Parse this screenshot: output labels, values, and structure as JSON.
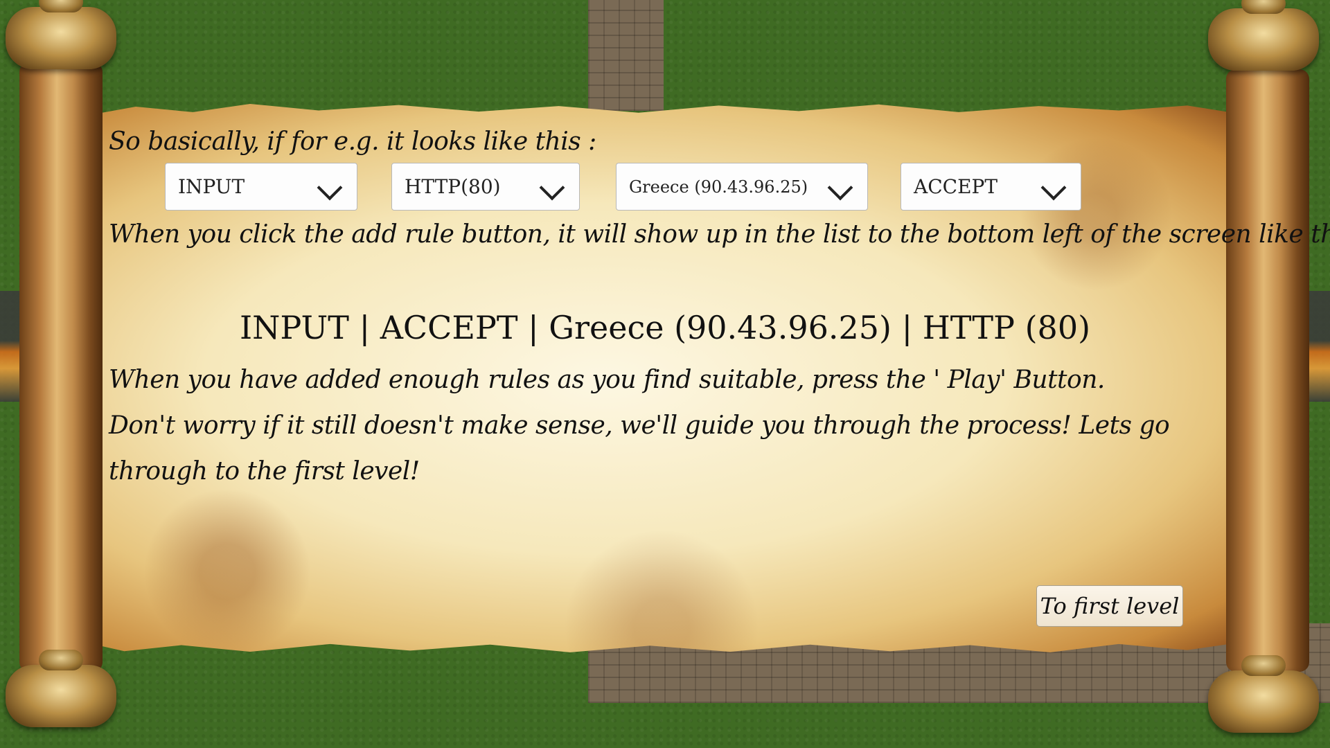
{
  "tutorial": {
    "intro": "So basically, if for e.g. it looks like this :",
    "dropdowns": {
      "direction": "INPUT",
      "protocol": "HTTP(80)",
      "address": "Greece (90.43.96.25)",
      "action": "ACCEPT"
    },
    "after_click": "When you click the add rule button, it will show up in the list to the bottom left of the screen like this:",
    "rule_preview": "INPUT | ACCEPT | Greece (90.43.96.25) | HTTP (80)",
    "final_text": "When you have added enough rules as you find suitable, press the ' Play' Button. Don't worry if it still doesn't make sense, we'll guide you through the process! Lets go through to the first level!",
    "next_button": "To first level"
  }
}
